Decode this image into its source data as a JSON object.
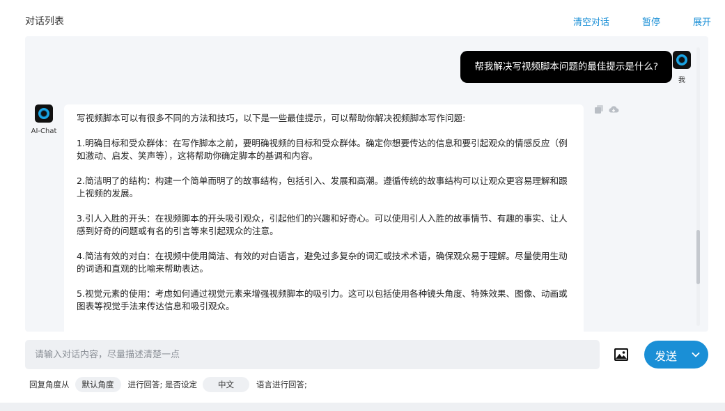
{
  "header": {
    "title": "对话列表",
    "actions": [
      "清空对话",
      "暂停",
      "展开"
    ]
  },
  "user_message": {
    "text": "帮我解决写视频脚本问题的最佳提示是什么?",
    "avatar_label": "我"
  },
  "ai_message": {
    "avatar_label": "AI-Chat",
    "paragraphs": [
      "写视频脚本可以有很多不同的方法和技巧，以下是一些最佳提示，可以帮助你解决视频脚本写作问题:",
      "1.明确目标和受众群体：在写作脚本之前，要明确视频的目标和受众群体。确定你想要传达的信息和要引起观众的情感反应（例如激动、启发、笑声等），这将帮助你确定脚本的基调和内容。",
      "2.简洁明了的结构：构建一个简单而明了的故事结构，包括引入、发展和高潮。遵循传统的故事结构可以让观众更容易理解和跟上视频的发展。",
      "3.引人入胜的开头：在视频脚本的开头吸引观众，引起他们的兴趣和好奇心。可以使用引人入胜的故事情节、有趣的事实、让人感到好奇的问题或有名的引言等来引起观众的注意。",
      "4.简洁有效的对白：在视频中使用简洁、有效的对白语言，避免过多复杂的词汇或技术术语，确保观众易于理解。尽量使用生动的词语和直观的比喻来帮助表达。",
      "5.视觉元素的使用：考虑如何通过视觉元素来增强视频脚本的吸引力。这可以包括使用各种镜头角度、特殊效果、图像、动画或图表等视觉手法来传达信息和吸引观众。"
    ]
  },
  "input": {
    "placeholder": "请输入对话内容，尽量描述清楚一点"
  },
  "send": {
    "label": "发送"
  },
  "options": {
    "prefix": "回复角度从",
    "angle_value": "默认角度",
    "middle": "进行回答; 是否设定",
    "language_value": "中文",
    "suffix": "语言进行回答;"
  },
  "colors": {
    "accent": "#1a8fd6",
    "user_bubble": "#000000",
    "panel_bg": "#f4f6f9"
  },
  "icons": {
    "copy": "copy-icon",
    "cloud": "cloud-icon",
    "image": "image-icon",
    "chevron": "chevron-down-icon"
  }
}
